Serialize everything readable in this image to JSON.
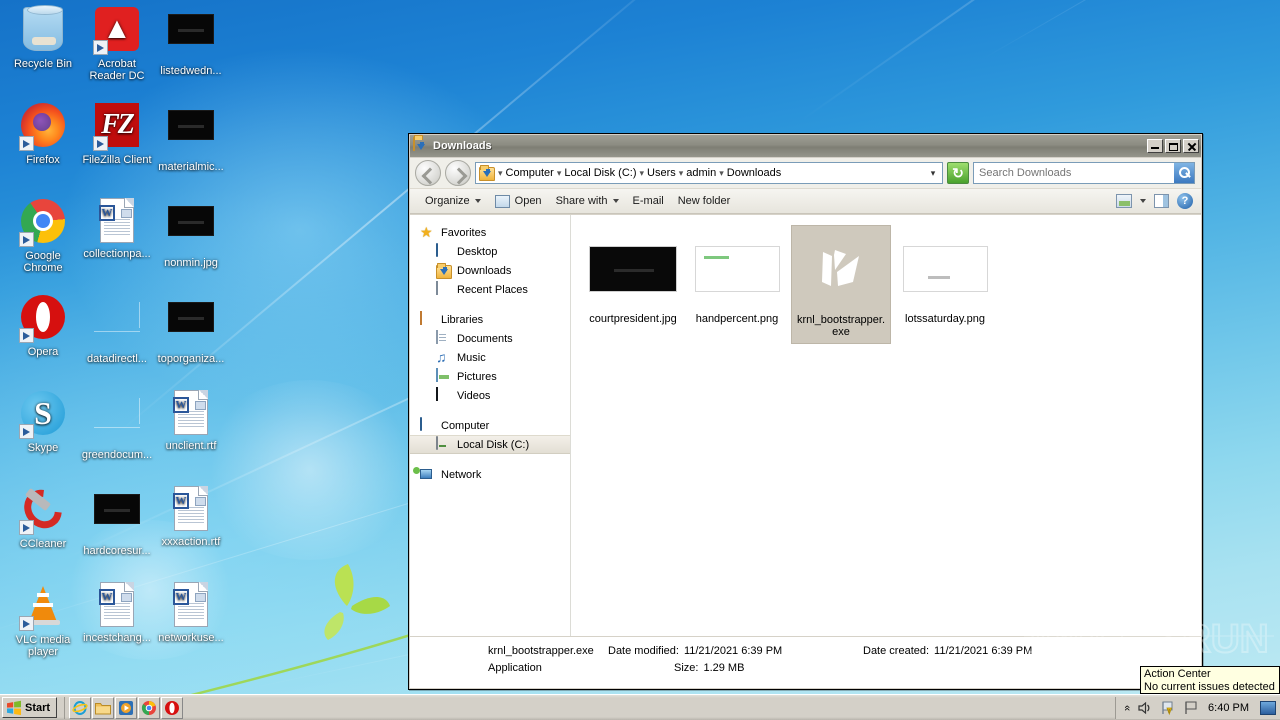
{
  "desktop": {
    "icons": [
      {
        "label": "Recycle Bin",
        "icon": "recycle-bin-icon",
        "kind": "recyclebin",
        "shortcut": false,
        "col": 0,
        "row": 0
      },
      {
        "label": "Acrobat\nReader DC",
        "icon": "acrobat-reader-icon",
        "kind": "acrobat",
        "shortcut": true,
        "col": 1,
        "row": 0
      },
      {
        "label": "listedwedn...",
        "icon": "image-file-icon",
        "kind": "thumb-black",
        "shortcut": false,
        "col": 2,
        "row": 0
      },
      {
        "label": "Firefox",
        "icon": "firefox-icon",
        "kind": "firefox",
        "shortcut": true,
        "col": 0,
        "row": 1
      },
      {
        "label": "FileZilla Client",
        "icon": "filezilla-icon",
        "kind": "filezilla",
        "shortcut": true,
        "col": 1,
        "row": 1
      },
      {
        "label": "materialmic...",
        "icon": "image-file-icon",
        "kind": "thumb-black",
        "shortcut": false,
        "col": 2,
        "row": 1
      },
      {
        "label": "Google\nChrome",
        "icon": "chrome-icon",
        "kind": "chrome",
        "shortcut": true,
        "col": 0,
        "row": 2
      },
      {
        "label": "collectionpa...",
        "icon": "word-document-icon",
        "kind": "worddoc",
        "shortcut": false,
        "col": 1,
        "row": 2
      },
      {
        "label": "nonmin.jpg",
        "icon": "image-file-icon",
        "kind": "thumb-black",
        "shortcut": false,
        "col": 2,
        "row": 2
      },
      {
        "label": "Opera",
        "icon": "opera-icon",
        "kind": "opera",
        "shortcut": true,
        "col": 0,
        "row": 3
      },
      {
        "label": "datadirectl...",
        "icon": "image-file-icon",
        "kind": "thumb-faint",
        "shortcut": false,
        "col": 1,
        "row": 3
      },
      {
        "label": "toporganiza...",
        "icon": "image-file-icon",
        "kind": "thumb-black",
        "shortcut": false,
        "col": 2,
        "row": 3
      },
      {
        "label": "Skype",
        "icon": "skype-icon",
        "kind": "skype",
        "shortcut": true,
        "col": 0,
        "row": 4
      },
      {
        "label": "greendocum...",
        "icon": "image-file-icon",
        "kind": "thumb-faint",
        "shortcut": false,
        "col": 1,
        "row": 4
      },
      {
        "label": "unclient.rtf",
        "icon": "word-document-icon",
        "kind": "worddoc",
        "shortcut": false,
        "col": 2,
        "row": 4
      },
      {
        "label": "CCleaner",
        "icon": "ccleaner-icon",
        "kind": "ccleaner",
        "shortcut": true,
        "col": 0,
        "row": 5
      },
      {
        "label": "hardcoresur...",
        "icon": "image-file-icon",
        "kind": "thumb-black",
        "shortcut": false,
        "col": 1,
        "row": 5
      },
      {
        "label": "xxxaction.rtf",
        "icon": "word-document-icon",
        "kind": "worddoc",
        "shortcut": false,
        "col": 2,
        "row": 5
      },
      {
        "label": "VLC media\nplayer",
        "icon": "vlc-icon",
        "kind": "vlc",
        "shortcut": true,
        "col": 0,
        "row": 6
      },
      {
        "label": "incestchang...",
        "icon": "word-document-icon",
        "kind": "worddoc",
        "shortcut": false,
        "col": 1,
        "row": 6
      },
      {
        "label": "networkuse...",
        "icon": "word-document-icon",
        "kind": "worddoc",
        "shortcut": false,
        "col": 2,
        "row": 6
      }
    ]
  },
  "explorer": {
    "title": "Downloads",
    "window_buttons": {
      "minimize": "Minimize",
      "maximize": "Maximize",
      "close": "Close"
    },
    "address": {
      "crumbs": [
        "Computer",
        "Local Disk (C:)",
        "Users",
        "admin",
        "Downloads"
      ],
      "separator": "▾",
      "dropdown": "▾",
      "refresh_title": "Refresh"
    },
    "search": {
      "placeholder": "Search Downloads",
      "value": ""
    },
    "commandbar": {
      "organize": "Organize",
      "open": "Open",
      "share_with": "Share with",
      "email": "E-mail",
      "new_folder": "New folder"
    },
    "navpane": [
      {
        "label": "Favorites",
        "icon": "favorites-star-icon",
        "level": 0,
        "selected": false
      },
      {
        "label": "Desktop",
        "icon": "desktop-icon",
        "level": 1,
        "selected": false
      },
      {
        "label": "Downloads",
        "icon": "downloads-folder-icon",
        "level": 1,
        "selected": false
      },
      {
        "label": "Recent Places",
        "icon": "recent-places-icon",
        "level": 1,
        "selected": false
      },
      {
        "label": "Libraries",
        "icon": "libraries-icon",
        "level": 0,
        "selected": false,
        "gap_before": true
      },
      {
        "label": "Documents",
        "icon": "documents-icon",
        "level": 1,
        "selected": false
      },
      {
        "label": "Music",
        "icon": "music-icon",
        "level": 1,
        "selected": false
      },
      {
        "label": "Pictures",
        "icon": "pictures-icon",
        "level": 1,
        "selected": false
      },
      {
        "label": "Videos",
        "icon": "videos-icon",
        "level": 1,
        "selected": false
      },
      {
        "label": "Computer",
        "icon": "computer-icon",
        "level": 0,
        "selected": false,
        "gap_before": true
      },
      {
        "label": "Local Disk (C:)",
        "icon": "local-disk-icon",
        "level": 1,
        "selected": true
      },
      {
        "label": "Network",
        "icon": "network-icon",
        "level": 0,
        "selected": false,
        "gap_before": true
      }
    ],
    "files": [
      {
        "name": "courtpresident.jpg",
        "thumb": "black-image",
        "selected": false
      },
      {
        "name": "handpercent.png",
        "thumb": "white-green",
        "selected": false
      },
      {
        "name": "krnl_bootstrapper.exe",
        "thumb": "krnl-k-logo",
        "selected": true
      },
      {
        "name": "lotssaturday.png",
        "thumb": "white-grey",
        "selected": false
      }
    ],
    "details": {
      "file_name": "krnl_bootstrapper.exe",
      "file_type": "Application",
      "date_modified_label": "Date modified:",
      "date_modified_value": "11/21/2021 6:39 PM",
      "date_created_label": "Date created:",
      "date_created_value": "11/21/2021 6:39 PM",
      "size_label": "Size:",
      "size_value": "1.29 MB"
    }
  },
  "tooltip": {
    "title": "Action Center",
    "message": "No current issues detected"
  },
  "watermark": {
    "text": "ANY RUN"
  },
  "taskbar": {
    "start_label": "Start",
    "quicklaunch": [
      {
        "name": "internet-explorer-icon",
        "label": "Internet Explorer"
      },
      {
        "name": "explorer-folder-icon",
        "label": "Windows Explorer"
      },
      {
        "name": "media-player-icon",
        "label": "Windows Media Player"
      },
      {
        "name": "chrome-icon",
        "label": "Google Chrome"
      },
      {
        "name": "opera-icon",
        "label": "Opera"
      }
    ],
    "tray": {
      "chevron": "«",
      "icons": [
        "volume-icon",
        "action-center-flag-icon",
        "network-flag-icon"
      ],
      "time": "6:40 PM",
      "show_desktop": "Show desktop"
    }
  },
  "colors": {
    "desktop_top": "#1572c8",
    "desktop_bottom": "#bde9f3",
    "window_chrome": "#d4d0c8",
    "titlebar": "#8c8c82",
    "selection": "#cfc9bd",
    "tooltip_bg": "#ffffe1",
    "refresh_green": "#4aa12c",
    "search_blue": "#3c79c0"
  }
}
